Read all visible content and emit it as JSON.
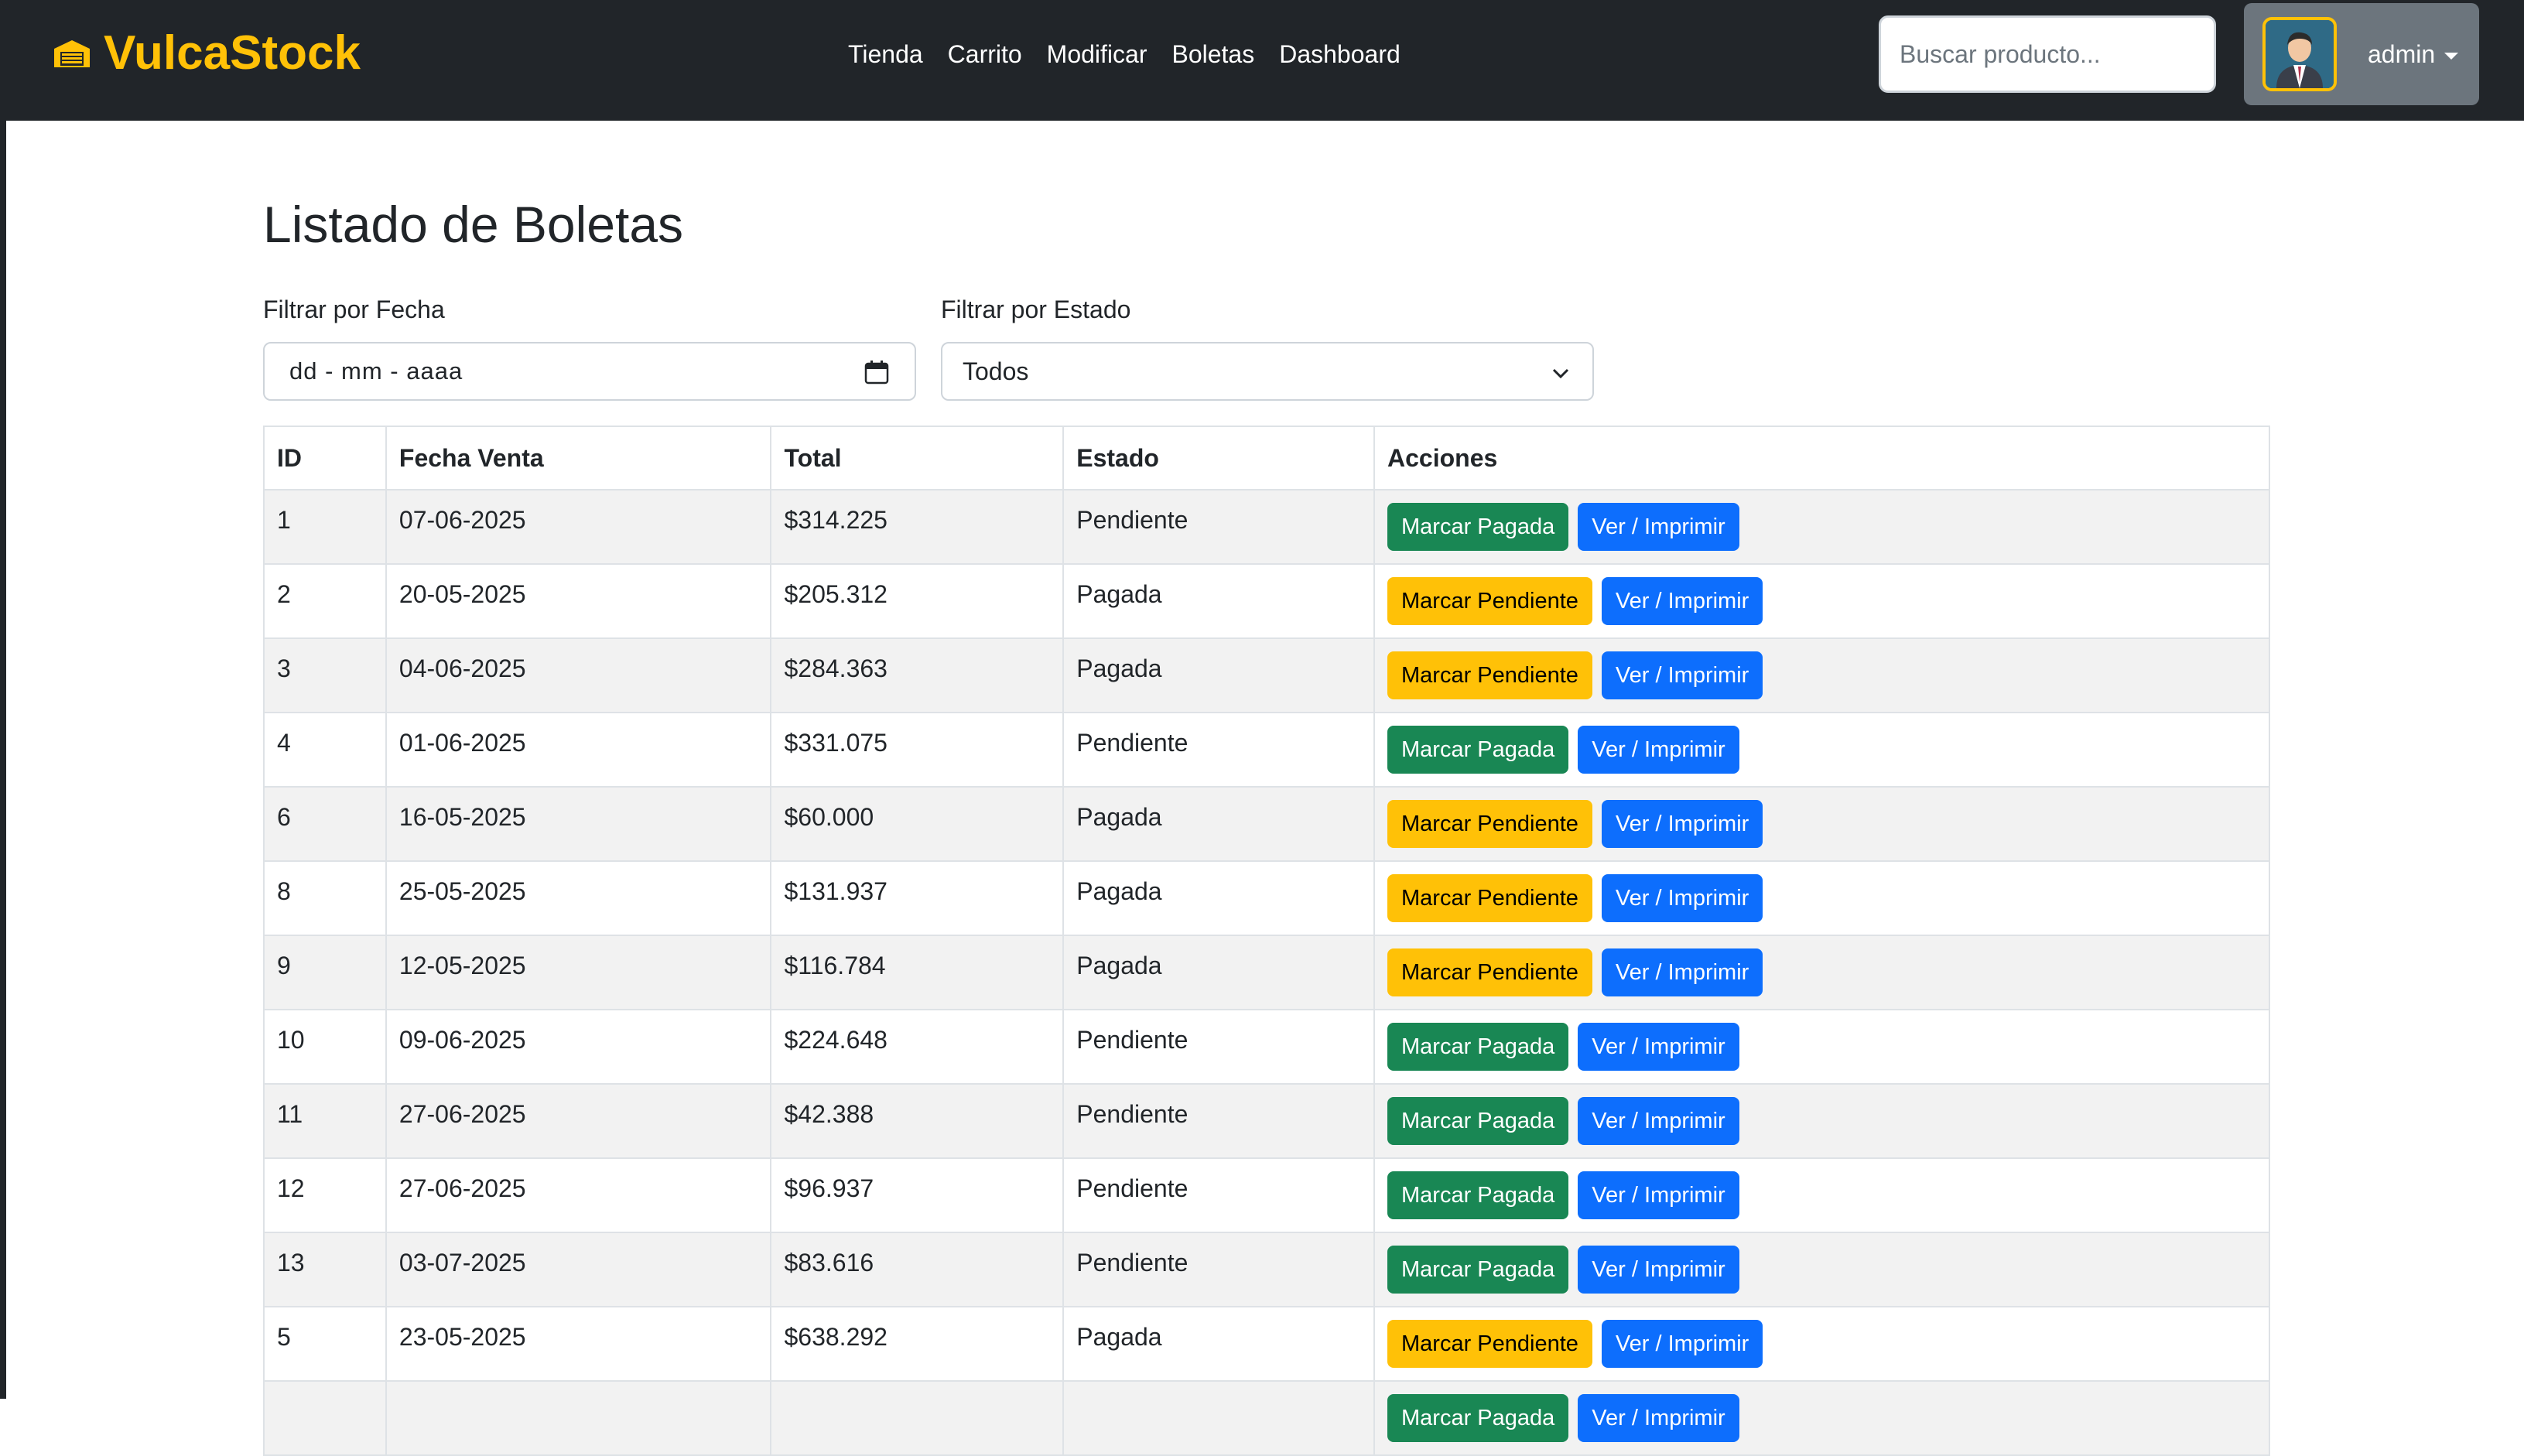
{
  "brand": {
    "name": "VulcaStock"
  },
  "nav": {
    "links": [
      "Tienda",
      "Carrito",
      "Modificar",
      "Boletas",
      "Dashboard"
    ]
  },
  "search": {
    "placeholder": "Buscar producto..."
  },
  "user": {
    "name": "admin"
  },
  "page": {
    "title": "Listado de Boletas"
  },
  "filters": {
    "date_label": "Filtrar por Fecha",
    "date_placeholder": "dd - mm - aaaa",
    "status_label": "Filtrar por Estado",
    "status_selected": "Todos"
  },
  "table": {
    "headers": [
      "ID",
      "Fecha Venta",
      "Total",
      "Estado",
      "Acciones"
    ],
    "rows": [
      {
        "id": "1",
        "fecha": "07-06-2025",
        "total": "$314.225",
        "estado": "Pendiente",
        "action": "Marcar Pagada",
        "view": "Ver / Imprimir"
      },
      {
        "id": "2",
        "fecha": "20-05-2025",
        "total": "$205.312",
        "estado": "Pagada",
        "action": "Marcar Pendiente",
        "view": "Ver / Imprimir"
      },
      {
        "id": "3",
        "fecha": "04-06-2025",
        "total": "$284.363",
        "estado": "Pagada",
        "action": "Marcar Pendiente",
        "view": "Ver / Imprimir"
      },
      {
        "id": "4",
        "fecha": "01-06-2025",
        "total": "$331.075",
        "estado": "Pendiente",
        "action": "Marcar Pagada",
        "view": "Ver / Imprimir"
      },
      {
        "id": "6",
        "fecha": "16-05-2025",
        "total": "$60.000",
        "estado": "Pagada",
        "action": "Marcar Pendiente",
        "view": "Ver / Imprimir"
      },
      {
        "id": "8",
        "fecha": "25-05-2025",
        "total": "$131.937",
        "estado": "Pagada",
        "action": "Marcar Pendiente",
        "view": "Ver / Imprimir"
      },
      {
        "id": "9",
        "fecha": "12-05-2025",
        "total": "$116.784",
        "estado": "Pagada",
        "action": "Marcar Pendiente",
        "view": "Ver / Imprimir"
      },
      {
        "id": "10",
        "fecha": "09-06-2025",
        "total": "$224.648",
        "estado": "Pendiente",
        "action": "Marcar Pagada",
        "view": "Ver / Imprimir"
      },
      {
        "id": "11",
        "fecha": "27-06-2025",
        "total": "$42.388",
        "estado": "Pendiente",
        "action": "Marcar Pagada",
        "view": "Ver / Imprimir"
      },
      {
        "id": "12",
        "fecha": "27-06-2025",
        "total": "$96.937",
        "estado": "Pendiente",
        "action": "Marcar Pagada",
        "view": "Ver / Imprimir"
      },
      {
        "id": "13",
        "fecha": "03-07-2025",
        "total": "$83.616",
        "estado": "Pendiente",
        "action": "Marcar Pagada",
        "view": "Ver / Imprimir"
      },
      {
        "id": "5",
        "fecha": "23-05-2025",
        "total": "$638.292",
        "estado": "Pagada",
        "action": "Marcar Pendiente",
        "view": "Ver / Imprimir"
      },
      {
        "id": "",
        "fecha": "",
        "total": "",
        "estado": "",
        "action": "Marcar Pagada",
        "view": "Ver / Imprimir"
      }
    ]
  },
  "colors": {
    "navbar": "#212529",
    "brand": "#ffc107",
    "btn_paid": "#198754",
    "btn_pending": "#ffc107",
    "btn_view": "#0d6efd",
    "user_box": "#6c757d"
  },
  "icons": {
    "brand": "warehouse-icon",
    "calendar": "calendar-icon",
    "select": "chevron-down-icon",
    "dropdown": "caret-down-icon"
  }
}
